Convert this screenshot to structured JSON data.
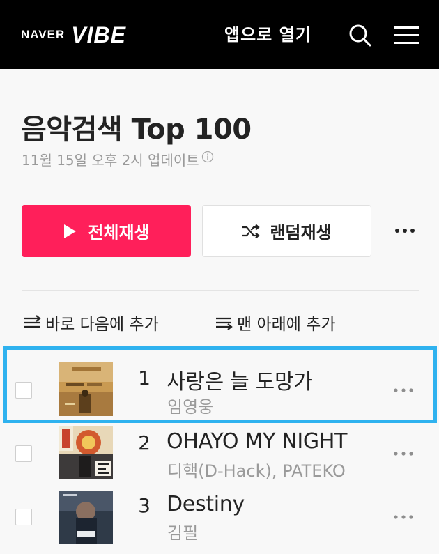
{
  "header": {
    "brand_naver": "NAVER",
    "brand_vibe": "VIBE",
    "open_app": "앱으로 열기",
    "icons": [
      "search-icon",
      "menu-icon"
    ]
  },
  "chart": {
    "title": "음악검색 Top 100",
    "updated": "11월 15일 오후 2시 업데이트"
  },
  "actions": {
    "play_all": "전체재생",
    "shuffle": "랜덤재생",
    "add_next": "바로 다음에 추가",
    "add_bottom": "맨 아래에 추가"
  },
  "tracks": [
    {
      "rank": "1",
      "title": "사랑은 늘 도망가",
      "artist": "임영웅"
    },
    {
      "rank": "2",
      "title": "OHAYO MY NIGHT",
      "artist": "디핵(D-Hack), PATEKO"
    },
    {
      "rank": "3",
      "title": "Destiny",
      "artist": "김필"
    }
  ],
  "colors": {
    "accent": "#ff1f5a",
    "header_bg": "#000000",
    "highlight": "#2fb2ef",
    "secondary_text": "#9a9a9a"
  },
  "highlighted_track_rank": "1"
}
